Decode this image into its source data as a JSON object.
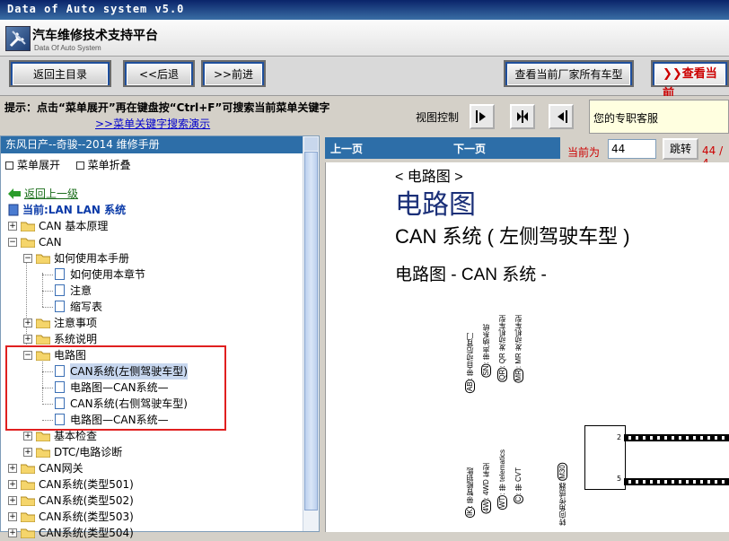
{
  "window": {
    "title": "Data of Auto system v5.0"
  },
  "app": {
    "title": "汽车维修技术支持平台",
    "subtitle": "Data Of Auto System"
  },
  "toolbar": {
    "home_label": "返回主目录",
    "back_label": "<<后退",
    "forward_label": ">>前进",
    "all_models_label": "查看当前厂家所有车型",
    "view_current_label": "查看当前"
  },
  "info": {
    "hint": "提示：点击“菜单展开”再在键盘按“Ctrl+F”可搜索当前菜单关键字",
    "demo_link": ">>菜单关键字搜索演示",
    "view_control_label": "视图控制",
    "service_label": "您的专职客服"
  },
  "left": {
    "header": "东风日产--奇骏--2014 维修手册",
    "expand_label": "菜单展开",
    "collapse_label": "菜单折叠",
    "back_up_label": "返回上一级",
    "current_label": "当前:LAN LAN 系统",
    "tree": [
      {
        "label": "CAN 基本原理"
      },
      {
        "label": "CAN"
      },
      {
        "label": "如何使用本手册"
      },
      {
        "label": "如何使用本章节"
      },
      {
        "label": "注意"
      },
      {
        "label": "缩写表"
      },
      {
        "label": "注意事项"
      },
      {
        "label": "系统说明"
      },
      {
        "label": "电路图"
      },
      {
        "label": "CAN系统(左侧驾驶车型)"
      },
      {
        "label": "电路图—CAN系统—"
      },
      {
        "label": "CAN系统(右侧驾驶车型)"
      },
      {
        "label": "电路图—CAN系统—"
      },
      {
        "label": "基本检查"
      },
      {
        "label": "DTC/电路诊断"
      },
      {
        "label": "CAN网关"
      },
      {
        "label": "CAN系统(类型501)"
      },
      {
        "label": "CAN系统(类型502)"
      },
      {
        "label": "CAN系统(类型503)"
      },
      {
        "label": "CAN系统(类型504)"
      }
    ]
  },
  "right": {
    "prev_label": "上一页",
    "next_label": "下一页",
    "current_page_label": "当前为",
    "page_value": "44",
    "jump_label": "跳转",
    "total_label": "44 / 4",
    "doc": {
      "breadcrumb": "< 电路图 >",
      "title": "电路图",
      "subtitle": "CAN 系统 ( 左侧驾驶车型 )",
      "section": "电路图 - CAN 系统 -",
      "legend_top": [
        {
          "code": "AB",
          "text": ": 带自动后背门"
        },
        {
          "code": "SN",
          "text": ": 带声纳系统"
        },
        {
          "code": "QR",
          "text": ": QR 发动机车型"
        },
        {
          "code": "MR",
          "text": ": MR 发动机车型"
        }
      ],
      "legend_bottom": [
        {
          "code": "IK",
          "text": ": 带智能钥匙"
        },
        {
          "code": "4W",
          "text": ": 4WD 车型"
        },
        {
          "code": "WT",
          "text": ": 带 telematics"
        },
        {
          "code": "C",
          "text": ": 带 CVT"
        }
      ],
      "sensor_label": "转向角传感器",
      "sensor_code": "M30",
      "pin_top": "2",
      "pin_bottom": "5"
    }
  }
}
